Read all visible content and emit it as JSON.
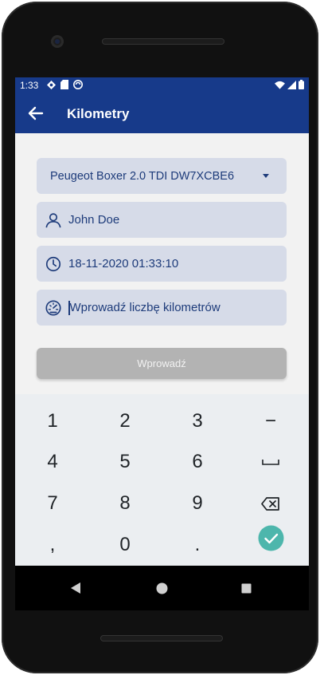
{
  "status_bar": {
    "time": "1:33"
  },
  "app_bar": {
    "title": "Kilometry"
  },
  "form": {
    "vehicle_selected": "Peugeot Boxer 2.0 TDI DW7XCBE6",
    "driver_name": "John Doe",
    "datetime": "18-11-2020 01:33:10",
    "km_placeholder": "Wprowadź liczbę kilometrów",
    "km_value": "",
    "submit_label": "Wprowadź"
  },
  "keyboard": {
    "keys": [
      "1",
      "2",
      "3",
      "−",
      "4",
      "5",
      "6",
      "␣",
      "7",
      "8",
      "9",
      "⌫",
      ",",
      "0",
      ".",
      "✓"
    ]
  },
  "colors": {
    "primary": "#173a8a",
    "field_bg": "#d6dbe8",
    "field_text": "#1d3b7a",
    "disabled_button": "#b3b3b3",
    "confirm_key": "#4db6ac"
  }
}
